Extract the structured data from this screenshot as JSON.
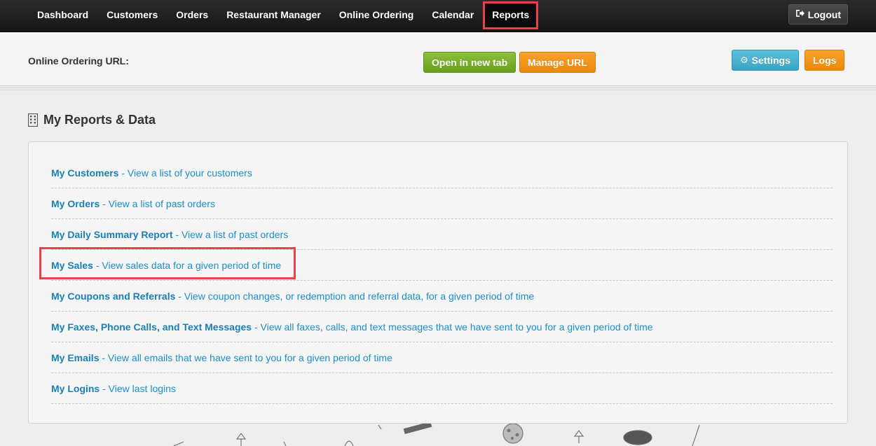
{
  "nav": {
    "items": [
      {
        "label": "Dashboard"
      },
      {
        "label": "Customers"
      },
      {
        "label": "Orders"
      },
      {
        "label": "Restaurant Manager"
      },
      {
        "label": "Online Ordering"
      },
      {
        "label": "Calendar"
      },
      {
        "label": "Reports"
      }
    ],
    "active": "Reports",
    "logout_label": "Logout"
  },
  "urlbar": {
    "label": "Online Ordering URL:",
    "open_label": "Open in new tab",
    "manage_label": "Manage URL",
    "settings_label": "Settings",
    "logs_label": "Logs"
  },
  "main": {
    "title": "My Reports & Data",
    "reports": [
      {
        "name": "My Customers",
        "desc": " - View a list of your customers"
      },
      {
        "name": "My Orders",
        "desc": " - View a list of past orders"
      },
      {
        "name": "My Daily Summary Report",
        "desc": " - View a list of past orders"
      },
      {
        "name": "My Sales",
        "desc": " - View sales data for a given period of time"
      },
      {
        "name": "My Coupons and Referrals",
        "desc": " - View coupon changes, or redemption and referral data, for a given period of time"
      },
      {
        "name": "My Faxes, Phone Calls, and Text Messages",
        "desc": " - View all faxes, calls, and text messages that we have sent to you for a given period of time"
      },
      {
        "name": "My Emails",
        "desc": " - View all emails that we have sent to you for a given period of time"
      },
      {
        "name": "My Logins",
        "desc": " - View last logins"
      }
    ]
  },
  "colors": {
    "accent_link": "#1a7fb5",
    "highlight": "#e8414a",
    "green": "#7ab02c",
    "orange": "#f39418",
    "teal": "#4bb2d1"
  }
}
